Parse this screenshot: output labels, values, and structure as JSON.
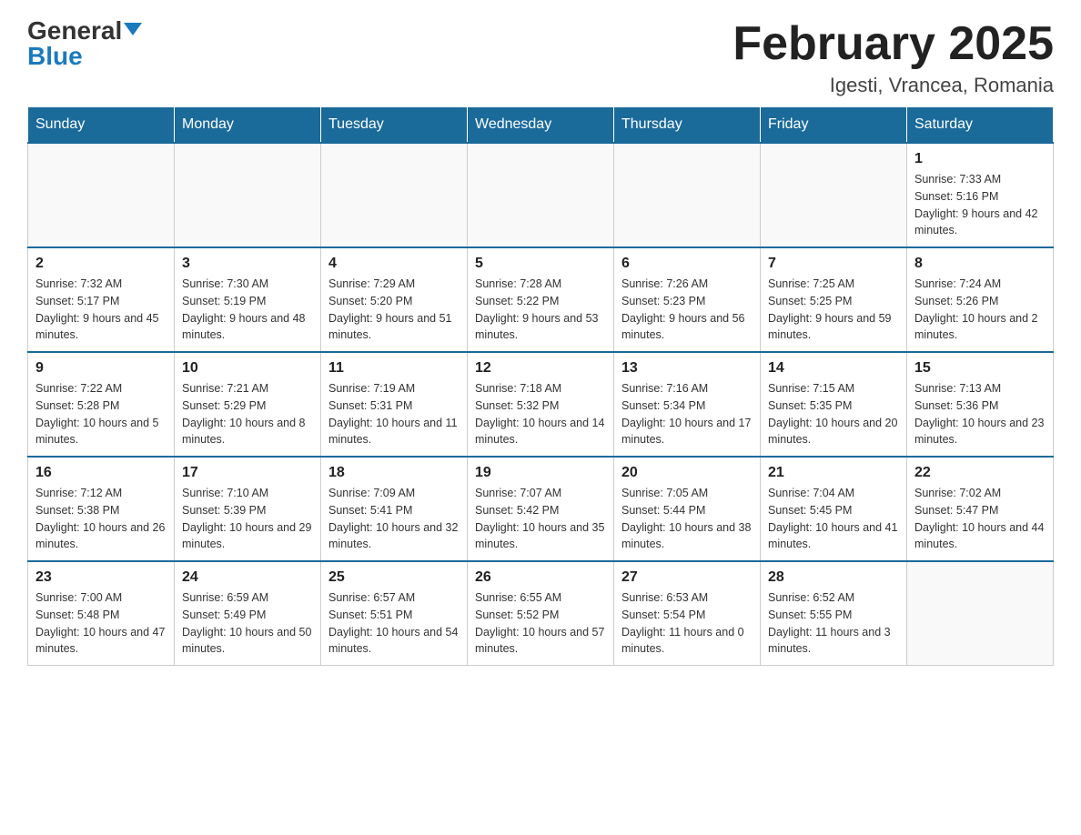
{
  "header": {
    "logo_general": "General",
    "logo_blue": "Blue",
    "month_title": "February 2025",
    "location": "Igesti, Vrancea, Romania"
  },
  "days_of_week": [
    "Sunday",
    "Monday",
    "Tuesday",
    "Wednesday",
    "Thursday",
    "Friday",
    "Saturday"
  ],
  "weeks": [
    [
      {
        "day": "",
        "info": ""
      },
      {
        "day": "",
        "info": ""
      },
      {
        "day": "",
        "info": ""
      },
      {
        "day": "",
        "info": ""
      },
      {
        "day": "",
        "info": ""
      },
      {
        "day": "",
        "info": ""
      },
      {
        "day": "1",
        "info": "Sunrise: 7:33 AM\nSunset: 5:16 PM\nDaylight: 9 hours and 42 minutes."
      }
    ],
    [
      {
        "day": "2",
        "info": "Sunrise: 7:32 AM\nSunset: 5:17 PM\nDaylight: 9 hours and 45 minutes."
      },
      {
        "day": "3",
        "info": "Sunrise: 7:30 AM\nSunset: 5:19 PM\nDaylight: 9 hours and 48 minutes."
      },
      {
        "day": "4",
        "info": "Sunrise: 7:29 AM\nSunset: 5:20 PM\nDaylight: 9 hours and 51 minutes."
      },
      {
        "day": "5",
        "info": "Sunrise: 7:28 AM\nSunset: 5:22 PM\nDaylight: 9 hours and 53 minutes."
      },
      {
        "day": "6",
        "info": "Sunrise: 7:26 AM\nSunset: 5:23 PM\nDaylight: 9 hours and 56 minutes."
      },
      {
        "day": "7",
        "info": "Sunrise: 7:25 AM\nSunset: 5:25 PM\nDaylight: 9 hours and 59 minutes."
      },
      {
        "day": "8",
        "info": "Sunrise: 7:24 AM\nSunset: 5:26 PM\nDaylight: 10 hours and 2 minutes."
      }
    ],
    [
      {
        "day": "9",
        "info": "Sunrise: 7:22 AM\nSunset: 5:28 PM\nDaylight: 10 hours and 5 minutes."
      },
      {
        "day": "10",
        "info": "Sunrise: 7:21 AM\nSunset: 5:29 PM\nDaylight: 10 hours and 8 minutes."
      },
      {
        "day": "11",
        "info": "Sunrise: 7:19 AM\nSunset: 5:31 PM\nDaylight: 10 hours and 11 minutes."
      },
      {
        "day": "12",
        "info": "Sunrise: 7:18 AM\nSunset: 5:32 PM\nDaylight: 10 hours and 14 minutes."
      },
      {
        "day": "13",
        "info": "Sunrise: 7:16 AM\nSunset: 5:34 PM\nDaylight: 10 hours and 17 minutes."
      },
      {
        "day": "14",
        "info": "Sunrise: 7:15 AM\nSunset: 5:35 PM\nDaylight: 10 hours and 20 minutes."
      },
      {
        "day": "15",
        "info": "Sunrise: 7:13 AM\nSunset: 5:36 PM\nDaylight: 10 hours and 23 minutes."
      }
    ],
    [
      {
        "day": "16",
        "info": "Sunrise: 7:12 AM\nSunset: 5:38 PM\nDaylight: 10 hours and 26 minutes."
      },
      {
        "day": "17",
        "info": "Sunrise: 7:10 AM\nSunset: 5:39 PM\nDaylight: 10 hours and 29 minutes."
      },
      {
        "day": "18",
        "info": "Sunrise: 7:09 AM\nSunset: 5:41 PM\nDaylight: 10 hours and 32 minutes."
      },
      {
        "day": "19",
        "info": "Sunrise: 7:07 AM\nSunset: 5:42 PM\nDaylight: 10 hours and 35 minutes."
      },
      {
        "day": "20",
        "info": "Sunrise: 7:05 AM\nSunset: 5:44 PM\nDaylight: 10 hours and 38 minutes."
      },
      {
        "day": "21",
        "info": "Sunrise: 7:04 AM\nSunset: 5:45 PM\nDaylight: 10 hours and 41 minutes."
      },
      {
        "day": "22",
        "info": "Sunrise: 7:02 AM\nSunset: 5:47 PM\nDaylight: 10 hours and 44 minutes."
      }
    ],
    [
      {
        "day": "23",
        "info": "Sunrise: 7:00 AM\nSunset: 5:48 PM\nDaylight: 10 hours and 47 minutes."
      },
      {
        "day": "24",
        "info": "Sunrise: 6:59 AM\nSunset: 5:49 PM\nDaylight: 10 hours and 50 minutes."
      },
      {
        "day": "25",
        "info": "Sunrise: 6:57 AM\nSunset: 5:51 PM\nDaylight: 10 hours and 54 minutes."
      },
      {
        "day": "26",
        "info": "Sunrise: 6:55 AM\nSunset: 5:52 PM\nDaylight: 10 hours and 57 minutes."
      },
      {
        "day": "27",
        "info": "Sunrise: 6:53 AM\nSunset: 5:54 PM\nDaylight: 11 hours and 0 minutes."
      },
      {
        "day": "28",
        "info": "Sunrise: 6:52 AM\nSunset: 5:55 PM\nDaylight: 11 hours and 3 minutes."
      },
      {
        "day": "",
        "info": ""
      }
    ]
  ]
}
